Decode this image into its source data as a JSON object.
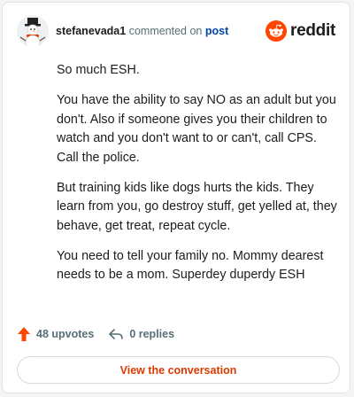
{
  "comment": {
    "author": "stefanevada1",
    "action": "commented on",
    "target_link": "post",
    "paragraphs": [
      "So much ESH.",
      "You have the ability to say NO as an adult but you don't. Also if someone gives you their children to watch and you don't want to or can't, call CPS. Call the police.",
      "But training kids like dogs hurts the kids. They learn from you, go destroy stuff, get yelled at, they behave, get treat, repeat cycle.",
      "You need to tell your family no. Mommy dearest needs to be a mom. Superdey duperdy ESH"
    ]
  },
  "brand": {
    "wordmark": "reddit",
    "logo_icon": "reddit-snoo-icon",
    "color": "#ff4500"
  },
  "stats": {
    "upvotes_label": "48 upvotes",
    "upvote_icon": "upvote-arrow-icon",
    "replies_label": "0 replies",
    "reply_icon": "reply-arrow-icon"
  },
  "cta": {
    "label": "View the conversation",
    "color": "#d93a00"
  }
}
